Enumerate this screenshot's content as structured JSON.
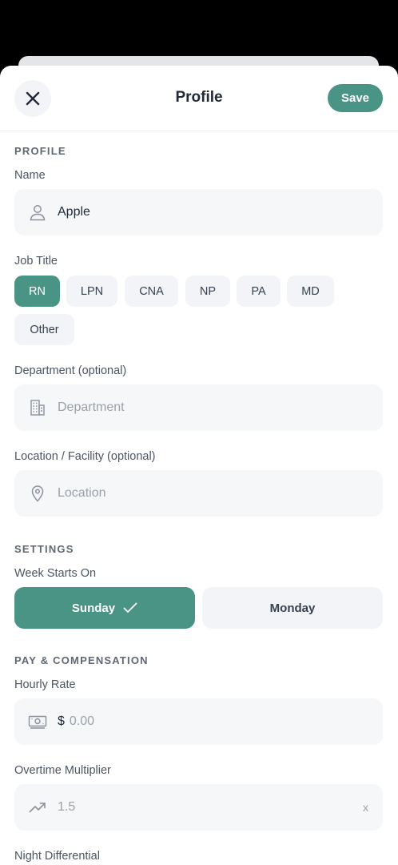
{
  "header": {
    "title": "Profile",
    "save_label": "Save"
  },
  "profile": {
    "section": "PROFILE",
    "name_label": "Name",
    "name_value": "Apple",
    "job_title_label": "Job Title",
    "job_titles": [
      "RN",
      "LPN",
      "CNA",
      "NP",
      "PA",
      "MD",
      "Other"
    ],
    "selected_job_title": "RN",
    "department_label": "Department (optional)",
    "department_placeholder": "Department",
    "location_label": "Location / Facility (optional)",
    "location_placeholder": "Location"
  },
  "settings": {
    "section": "SETTINGS",
    "week_start_label": "Week Starts On",
    "options": [
      "Sunday",
      "Monday"
    ],
    "selected": "Sunday"
  },
  "pay": {
    "section": "PAY & COMPENSATION",
    "hourly_rate_label": "Hourly Rate",
    "currency_symbol": "$",
    "hourly_rate_placeholder": "0.00",
    "overtime_label": "Overtime Multiplier",
    "overtime_placeholder": "1.5",
    "overtime_suffix": "x",
    "night_diff_label": "Night Differential"
  },
  "colors": {
    "accent": "#4a9485",
    "field_bg": "#f5f7f9",
    "chip_bg": "#f2f4f7"
  }
}
